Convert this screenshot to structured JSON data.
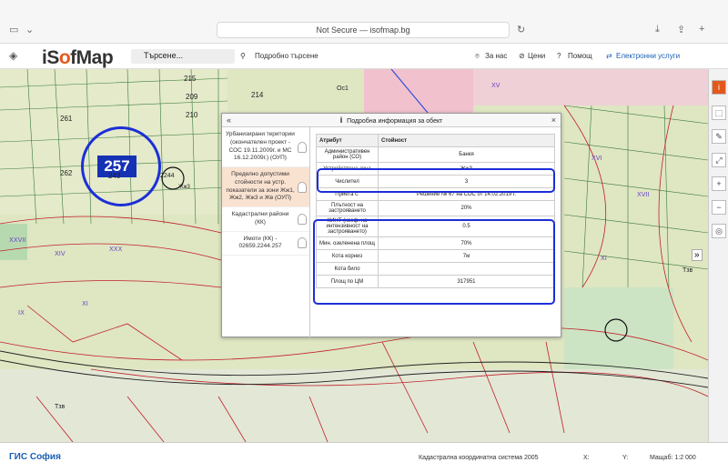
{
  "browser": {
    "url": "Not Secure — isofmap.bg"
  },
  "app": {
    "logo_prefix": "iS",
    "logo_o": "o",
    "logo_suffix": "fMap",
    "search_placeholder": "Търсене...",
    "advanced_search": "Подробно търсене"
  },
  "menu": {
    "about": "За нас",
    "prices": "Цени",
    "help": "Помощ",
    "services": "Електронни услуги"
  },
  "map_labels": {
    "parcel_257": "257",
    "p214": "214",
    "p215": "215",
    "p209": "209",
    "p210": "210",
    "p243": "243",
    "p261": "261",
    "p262": "262",
    "p2244": "2244",
    "zone": "Жж3",
    "tzv": "Тзв",
    "os": "Ос1"
  },
  "panel": {
    "title": "Подробна информация за обект",
    "layers": [
      "Урбанизирани територии (окончателен проект - СОС 19.11.2009г. и МС 16.12.2009г.) (ОУП)",
      "Пределно допустими стойности на устр. показатели за зони Жж1, Жж2, Жж3 и Жв (ОУП)",
      "Кадастрални райони (КК)",
      "Имоти (КК) - 02659.2244.257"
    ],
    "col_attr": "Атрибут",
    "col_value": "Стойност",
    "rows": [
      {
        "k": "Административен район (СО)",
        "v": "Банкя"
      },
      {
        "k": "Устройствена зона",
        "v": "Жж3"
      },
      {
        "k": "Числител",
        "v": "3"
      },
      {
        "k": "Приета с:",
        "v": "Решение № 67 на СОС от 14.02.2019 г."
      },
      {
        "k": "Плътност на застрояването",
        "v": "20%"
      },
      {
        "k": "КИНТ (коеф. на интензивност на застрояването)",
        "v": "0.5"
      },
      {
        "k": "Мин. озеленена площ",
        "v": "70%"
      },
      {
        "k": "Кота корниз",
        "v": "7м"
      },
      {
        "k": "Кота било",
        "v": ""
      },
      {
        "k": "Площ по ЦМ",
        "v": "317951"
      }
    ]
  },
  "footer": {
    "brand": "ГИС София",
    "coord_system": "Кадастрална координатна система 2005",
    "x_label": "X:",
    "y_label": "Y:",
    "scale": "Мащаб: 1:2 000"
  }
}
